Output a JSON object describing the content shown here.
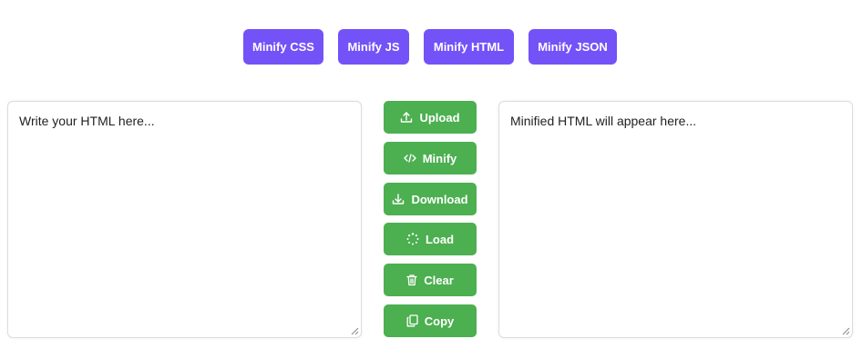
{
  "modes": [
    {
      "label": "Minify CSS",
      "name": "minify-css-button"
    },
    {
      "label": "Minify JS",
      "name": "minify-js-button"
    },
    {
      "label": "Minify HTML",
      "name": "minify-html-button"
    },
    {
      "label": "Minify JSON",
      "name": "minify-json-button"
    }
  ],
  "input": {
    "placeholder": "Write your HTML here...",
    "value": ""
  },
  "output": {
    "placeholder": "Minified HTML will appear here..."
  },
  "actions": [
    {
      "label": "Upload",
      "icon": "upload-icon"
    },
    {
      "label": "Minify",
      "icon": "code-icon"
    },
    {
      "label": "Download",
      "icon": "download-icon"
    },
    {
      "label": "Load",
      "icon": "spinner-icon"
    },
    {
      "label": "Clear",
      "icon": "trash-icon"
    },
    {
      "label": "Copy",
      "icon": "copy-icon"
    }
  ],
  "colors": {
    "mode_button": "#7352f8",
    "action_button": "#4caf50",
    "panel_border": "#dcdcdc"
  }
}
